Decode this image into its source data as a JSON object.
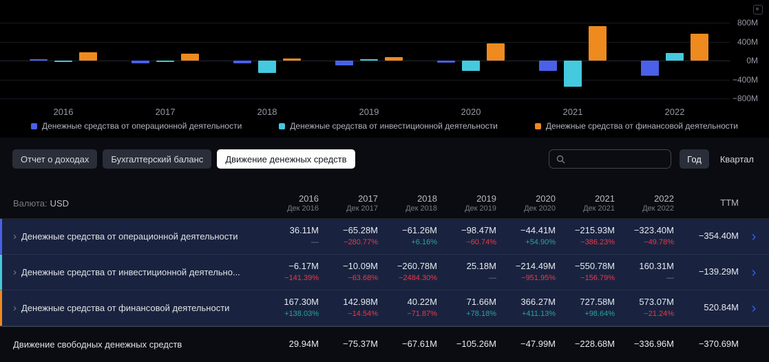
{
  "chart_data": {
    "type": "bar",
    "title": "",
    "categories": [
      "2016",
      "2017",
      "2018",
      "2019",
      "2020",
      "2021",
      "2022"
    ],
    "series": [
      {
        "key": "operating",
        "name": "Денежные средства от операционной деятельности",
        "color": "#4a60e8",
        "values": [
          36.11,
          -65.28,
          -61.26,
          -98.47,
          -44.41,
          -215.93,
          -323.4
        ]
      },
      {
        "key": "investing",
        "name": "Денежные средства от инвестиционной деятельности",
        "color": "#45c9de",
        "values": [
          -6.17,
          -10.09,
          -260.78,
          25.18,
          -214.49,
          -550.78,
          160.31
        ]
      },
      {
        "key": "financing",
        "name": "Денежные средства от финансовой деятельности",
        "color": "#ef8a1f",
        "values": [
          167.3,
          142.98,
          40.22,
          71.66,
          366.27,
          727.58,
          573.07
        ]
      }
    ],
    "unit": "M",
    "ylim": [
      -800,
      800
    ],
    "ytick_values": [
      800,
      400,
      0,
      -400,
      -800
    ],
    "ytick_labels": [
      "800M",
      "400M",
      "0M",
      "−400M",
      "−800M"
    ],
    "legend_position": "bottom",
    "grid": true
  },
  "tabs": [
    {
      "key": "income-statement",
      "label": "Отчет о доходах",
      "active": false
    },
    {
      "key": "balance-sheet",
      "label": "Бухгалтерский баланс",
      "active": false
    },
    {
      "key": "cash-flow",
      "label": "Движение денежных средств",
      "active": true
    }
  ],
  "toolbar": {
    "search_value": "",
    "search_placeholder": "",
    "year_label": "Год",
    "quarter_label": "Квартал",
    "selected_period": "Год"
  },
  "icons": {
    "chevron": "›"
  },
  "table": {
    "currency_label": "Валюта:",
    "currency_value": "USD",
    "columns": [
      {
        "year": "2016",
        "sub": "Дек 2016"
      },
      {
        "year": "2017",
        "sub": "Дек 2017"
      },
      {
        "year": "2018",
        "sub": "Дек 2018"
      },
      {
        "year": "2019",
        "sub": "Дек 2019"
      },
      {
        "year": "2020",
        "sub": "Дек 2020"
      },
      {
        "year": "2021",
        "sub": "Дек 2021"
      },
      {
        "year": "2022",
        "sub": "Дек 2022"
      },
      {
        "year": "TTM",
        "sub": ""
      }
    ],
    "rows": [
      {
        "key": "operating",
        "label": "Денежные средства от операционной деятельности",
        "accent": "#4a60e8",
        "highlighted": true,
        "expandable": true,
        "chevron": true,
        "cells": [
          {
            "v": "36.11M",
            "p": "—"
          },
          {
            "v": "−65.28M",
            "p": "−280.77%"
          },
          {
            "v": "−61.26M",
            "p": "+6.16%"
          },
          {
            "v": "−98.47M",
            "p": "−60.74%"
          },
          {
            "v": "−44.41M",
            "p": "+54.90%"
          },
          {
            "v": "−215.93M",
            "p": "−386.23%"
          },
          {
            "v": "−323.40M",
            "p": "−49.78%"
          },
          {
            "v": "−354.40M",
            "p": ""
          }
        ]
      },
      {
        "key": "investing",
        "label": "Денежные средства от инвестиционной деятельно...",
        "accent": "#45c9de",
        "highlighted": true,
        "expandable": true,
        "chevron": true,
        "cells": [
          {
            "v": "−6.17M",
            "p": "−141.39%"
          },
          {
            "v": "−10.09M",
            "p": "−63.68%"
          },
          {
            "v": "−260.78M",
            "p": "−2484.30%"
          },
          {
            "v": "25.18M",
            "p": "—"
          },
          {
            "v": "−214.49M",
            "p": "−951.95%"
          },
          {
            "v": "−550.78M",
            "p": "−156.79%"
          },
          {
            "v": "160.31M",
            "p": "—"
          },
          {
            "v": "−139.29M",
            "p": ""
          }
        ]
      },
      {
        "key": "financing",
        "label": "Денежные средства от финансовой деятельности",
        "accent": "#ef8a1f",
        "highlighted": true,
        "expandable": true,
        "chevron": true,
        "cells": [
          {
            "v": "167.30M",
            "p": "+138.03%"
          },
          {
            "v": "142.98M",
            "p": "−14.54%"
          },
          {
            "v": "40.22M",
            "p": "−71.87%"
          },
          {
            "v": "71.66M",
            "p": "+78.18%"
          },
          {
            "v": "366.27M",
            "p": "+411.13%"
          },
          {
            "v": "727.58M",
            "p": "+98.64%"
          },
          {
            "v": "573.07M",
            "p": "−21.24%"
          },
          {
            "v": "520.84M",
            "p": ""
          }
        ]
      },
      {
        "key": "free-cash-flow",
        "label": "Движение свободных денежных средств",
        "accent": null,
        "highlighted": false,
        "expandable": false,
        "chevron": false,
        "cells": [
          {
            "v": "29.94M",
            "p": ""
          },
          {
            "v": "−75.37M",
            "p": ""
          },
          {
            "v": "−67.61M",
            "p": ""
          },
          {
            "v": "−105.26M",
            "p": ""
          },
          {
            "v": "−47.99M",
            "p": ""
          },
          {
            "v": "−228.68M",
            "p": ""
          },
          {
            "v": "−336.96M",
            "p": ""
          },
          {
            "v": "−370.69M",
            "p": ""
          }
        ]
      }
    ]
  }
}
